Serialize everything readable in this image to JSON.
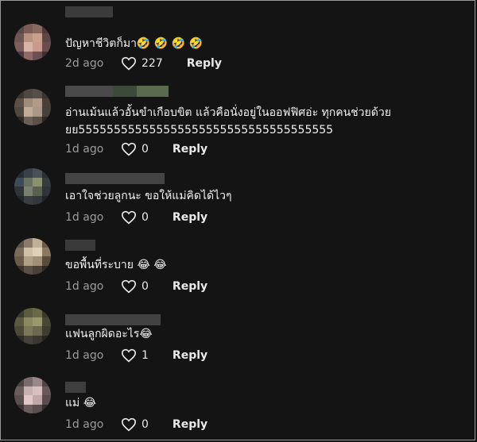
{
  "comments": [
    {
      "text": "ปัญหาชีวิตก็มา🤣 🤣 🤣 🤣",
      "age": "2d ago",
      "likes": "227",
      "reply": "Reply"
    },
    {
      "text": "อ่านเม้นแล้วอั้นขำเกือบขิต แล้วคือนั่งอยู่ในออฟฟิศอ่ะ ทุกคนช่วยด้วย\nยย555555555555555555555555555555555555",
      "age": "1d ago",
      "likes": "0",
      "reply": "Reply"
    },
    {
      "text": "เอาใจช่วยลูกนะ ขอให้แม่คิดได้ไวๆ",
      "age": "1d ago",
      "likes": "0",
      "reply": "Reply"
    },
    {
      "text": "ขอพื้นที่ระบาย 😂 😂",
      "age": "1d ago",
      "likes": "0",
      "reply": "Reply"
    },
    {
      "text": "แฟนลูกผิดอะไร😂",
      "age": "1d ago",
      "likes": "1",
      "reply": "Reply"
    },
    {
      "text": "แม่ 😂",
      "age": "1d ago",
      "likes": "0",
      "reply": "Reply"
    }
  ],
  "icons": {
    "like": "heart-outline-icon"
  },
  "colors": {
    "background": "#141414",
    "muted": "#9c9c9c",
    "text": "#f2f2f2"
  }
}
